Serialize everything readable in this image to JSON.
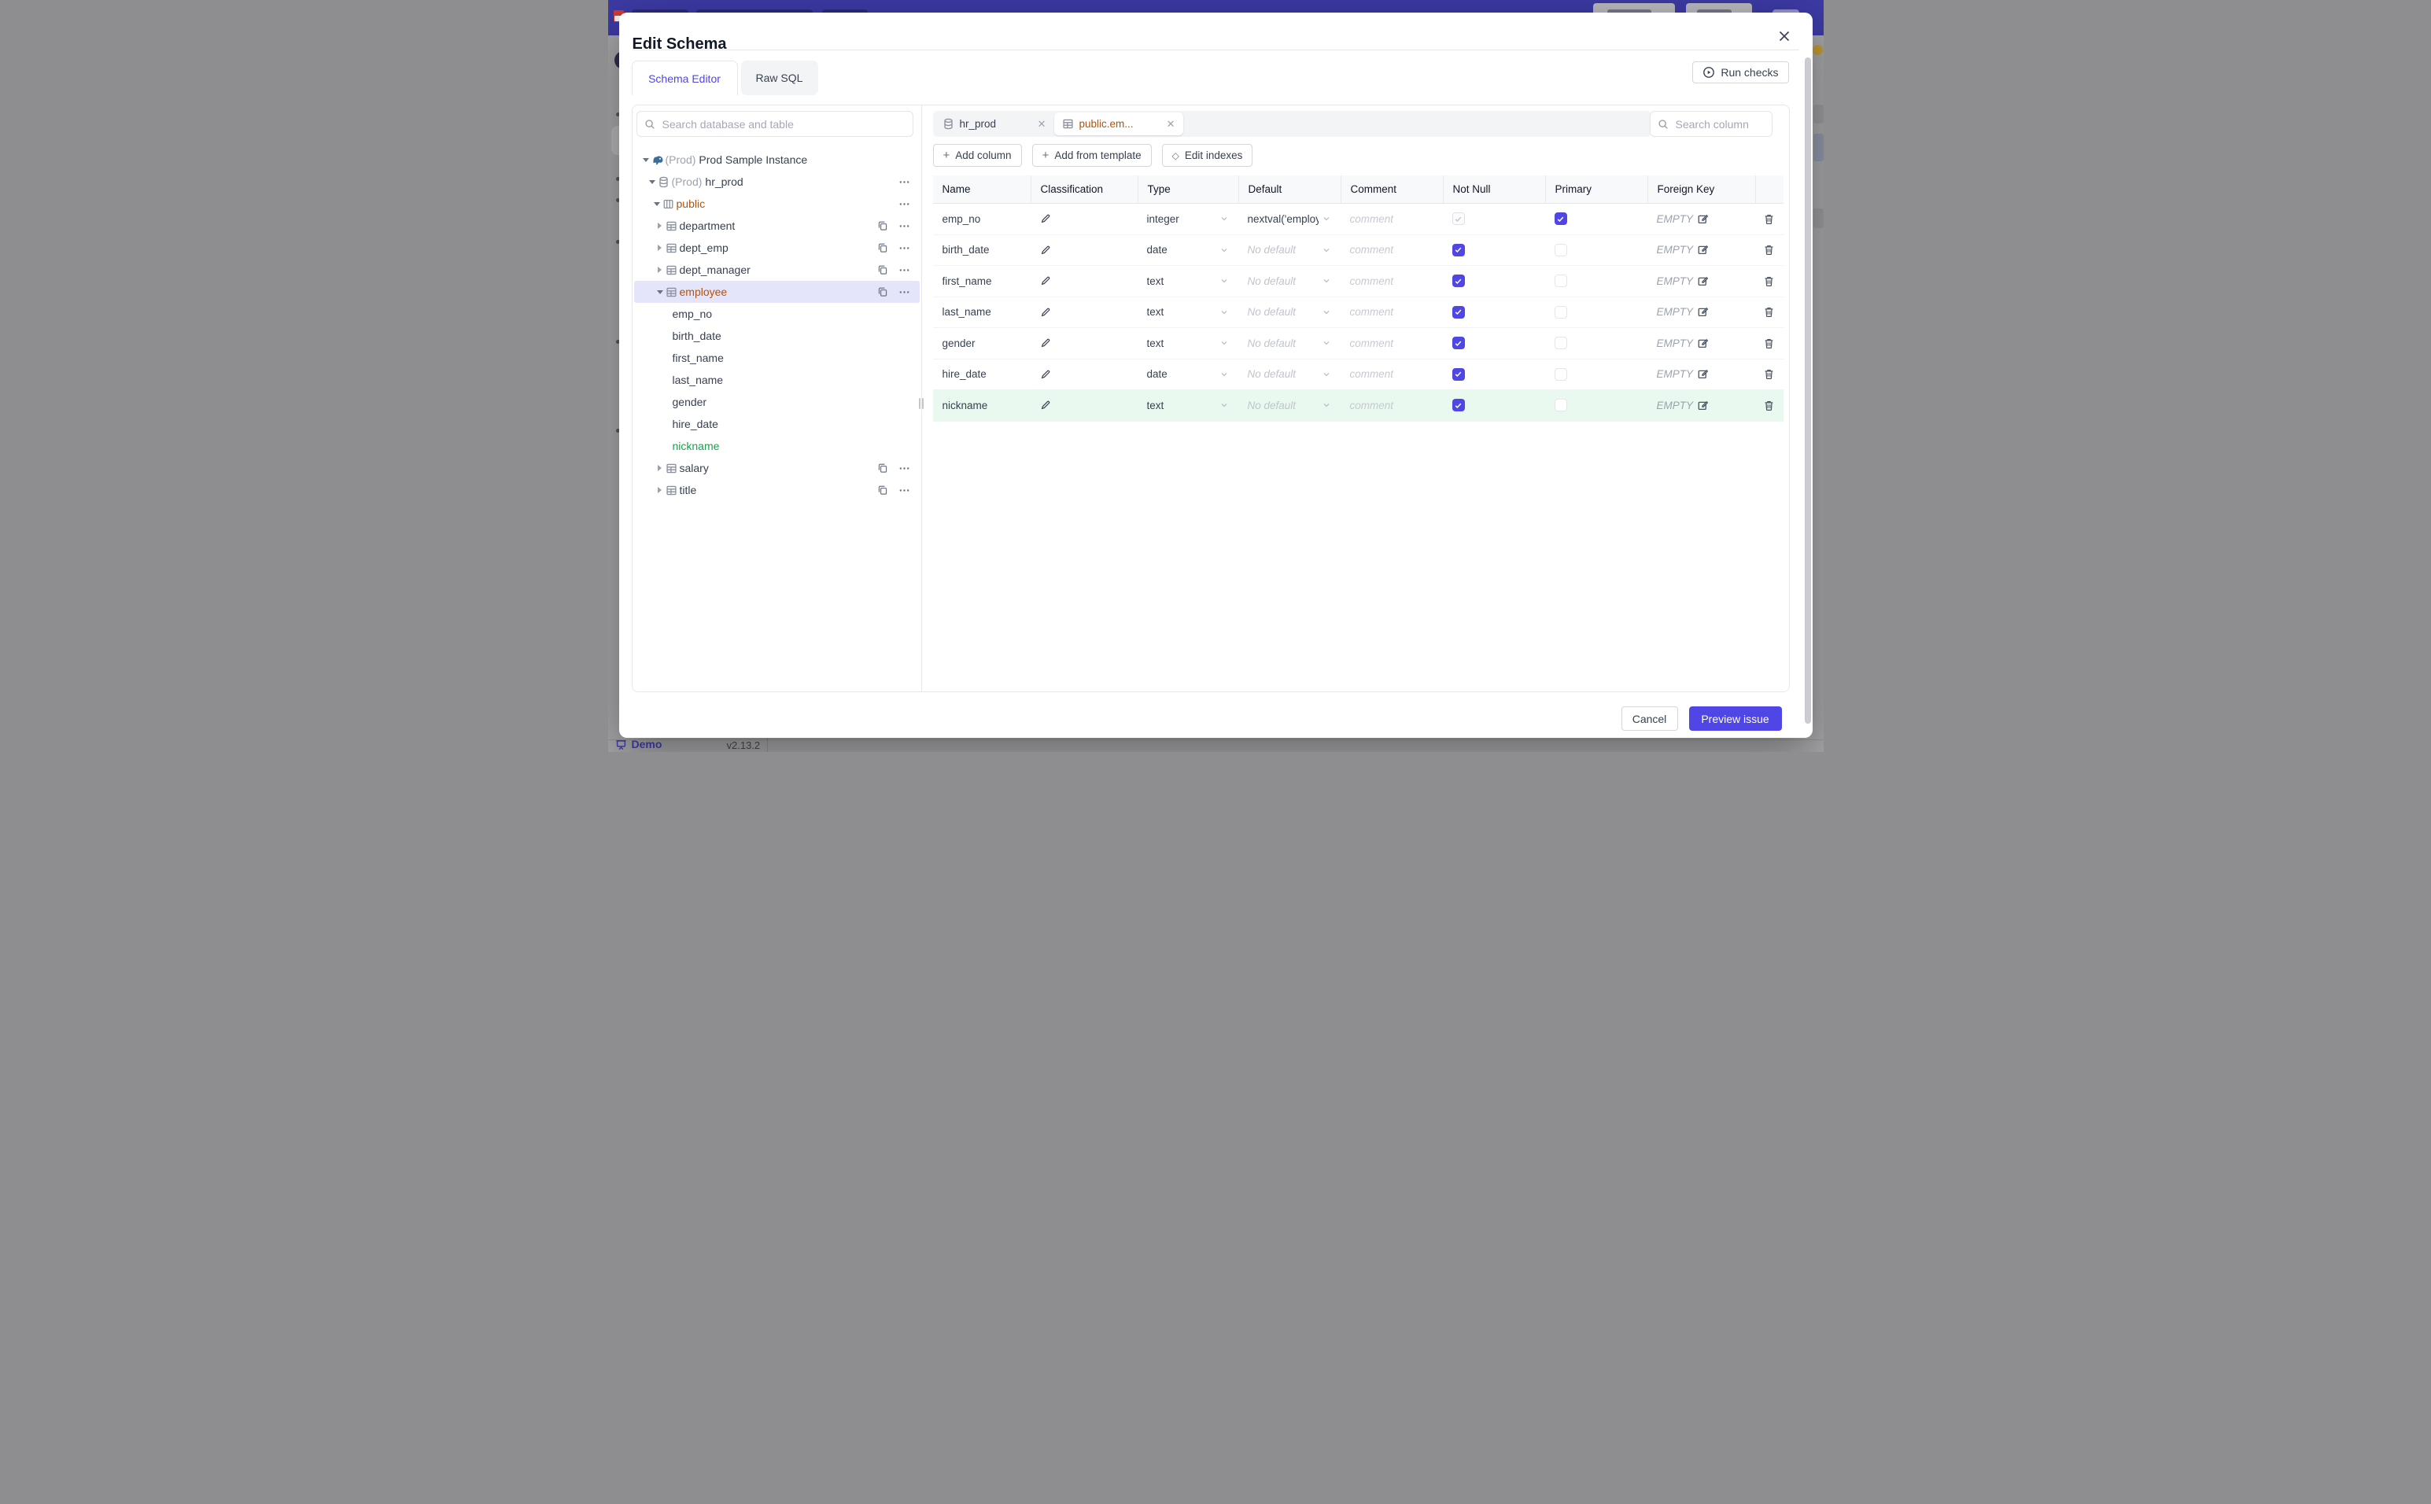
{
  "background": {
    "demo_label": "Demo",
    "version": "v2.13.2"
  },
  "dialog": {
    "title": "Edit Schema",
    "tabs": [
      {
        "label": "Schema Editor",
        "active": true
      },
      {
        "label": "Raw SQL",
        "active": false
      }
    ],
    "run_checks_label": "Run checks"
  },
  "sidebar": {
    "search_placeholder": "Search database and table",
    "tree": [
      {
        "label": "Prod Sample Instance",
        "prefix": "(Prod)",
        "type": "instance",
        "level": 0,
        "caret": "down",
        "actions": []
      },
      {
        "label": "hr_prod",
        "prefix": "(Prod)",
        "type": "database",
        "level": 1,
        "caret": "down",
        "actions": [
          "more"
        ]
      },
      {
        "label": "public",
        "type": "schema",
        "level": 2,
        "caret": "down",
        "color": "amber",
        "actions": [
          "more"
        ]
      },
      {
        "label": "department",
        "type": "table",
        "level": 3,
        "caret": "right",
        "actions": [
          "copy",
          "more"
        ]
      },
      {
        "label": "dept_emp",
        "type": "table",
        "level": 3,
        "caret": "right",
        "actions": [
          "copy",
          "more"
        ]
      },
      {
        "label": "dept_manager",
        "type": "table",
        "level": 3,
        "caret": "right",
        "actions": [
          "copy",
          "more"
        ]
      },
      {
        "label": "employee",
        "type": "table",
        "level": 3,
        "caret": "down",
        "color": "amber",
        "selected": true,
        "actions": [
          "copy",
          "more"
        ]
      },
      {
        "label": "emp_no",
        "type": "column",
        "level": 4
      },
      {
        "label": "birth_date",
        "type": "column",
        "level": 4
      },
      {
        "label": "first_name",
        "type": "column",
        "level": 4
      },
      {
        "label": "last_name",
        "type": "column",
        "level": 4
      },
      {
        "label": "gender",
        "type": "column",
        "level": 4
      },
      {
        "label": "hire_date",
        "type": "column",
        "level": 4
      },
      {
        "label": "nickname",
        "type": "column",
        "level": 4,
        "color": "green"
      },
      {
        "label": "salary",
        "type": "table",
        "level": 3,
        "caret": "right",
        "actions": [
          "copy",
          "more"
        ]
      },
      {
        "label": "title",
        "type": "table",
        "level": 3,
        "caret": "right",
        "actions": [
          "copy",
          "more"
        ]
      }
    ]
  },
  "editor": {
    "tabs": [
      {
        "label": "hr_prod",
        "icon": "database-icon",
        "active": false
      },
      {
        "label": "public.em...",
        "icon": "table-icon",
        "active": true
      }
    ],
    "actions": [
      {
        "label": "Add column",
        "icon": "plus"
      },
      {
        "label": "Add from template",
        "icon": "plus"
      },
      {
        "label": "Edit indexes",
        "icon": "diamond"
      }
    ],
    "column_search_placeholder": "Search column"
  },
  "table": {
    "headers": [
      "Name",
      "Classification",
      "Type",
      "Default",
      "Comment",
      "Not Null",
      "Primary",
      "Foreign Key",
      ""
    ],
    "comment_placeholder": "comment",
    "no_default_placeholder": "No default",
    "foreign_key_empty": "EMPTY",
    "rows": [
      {
        "name": "emp_no",
        "type": "integer",
        "default": "nextval('employ",
        "default_is_value": true,
        "not_null_checked": true,
        "not_null_disabled": true,
        "primary_checked": true,
        "new": false
      },
      {
        "name": "birth_date",
        "type": "date",
        "default": "No default",
        "default_is_value": false,
        "not_null_checked": true,
        "not_null_disabled": false,
        "primary_checked": false,
        "new": false
      },
      {
        "name": "first_name",
        "type": "text",
        "default": "No default",
        "default_is_value": false,
        "not_null_checked": true,
        "not_null_disabled": false,
        "primary_checked": false,
        "new": false
      },
      {
        "name": "last_name",
        "type": "text",
        "default": "No default",
        "default_is_value": false,
        "not_null_checked": true,
        "not_null_disabled": false,
        "primary_checked": false,
        "new": false
      },
      {
        "name": "gender",
        "type": "text",
        "default": "No default",
        "default_is_value": false,
        "not_null_checked": true,
        "not_null_disabled": false,
        "primary_checked": false,
        "new": false
      },
      {
        "name": "hire_date",
        "type": "date",
        "default": "No default",
        "default_is_value": false,
        "not_null_checked": true,
        "not_null_disabled": false,
        "primary_checked": false,
        "new": false
      },
      {
        "name": "nickname",
        "type": "text",
        "default": "No default",
        "default_is_value": false,
        "not_null_checked": true,
        "not_null_disabled": false,
        "primary_checked": false,
        "new": true
      }
    ]
  },
  "footer": {
    "cancel_label": "Cancel",
    "submit_label": "Preview issue"
  },
  "colors": {
    "accent": "#4f46e5",
    "amber": "#b45309",
    "green": "#16a34a",
    "selected_row_bg": "#e4e4fb",
    "new_row_bg": "#e9f9ef",
    "topbar": "#3d3aa5"
  }
}
